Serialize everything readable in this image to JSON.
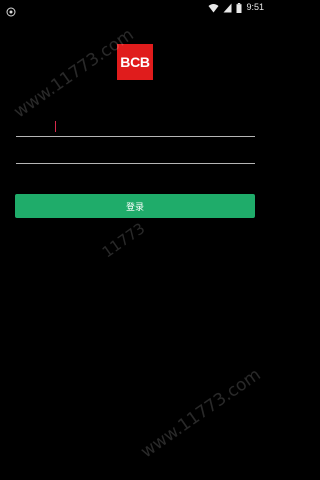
{
  "status_bar": {
    "time": "9:51",
    "icons": [
      "notification-icon",
      "wifi-icon",
      "signal-icon",
      "battery-icon"
    ]
  },
  "logo": {
    "text": "BCB",
    "color": "#e01c1c"
  },
  "login_form": {
    "username": {
      "value": "",
      "placeholder": ""
    },
    "password": {
      "value": "",
      "placeholder": ""
    },
    "submit_label": "登录",
    "submit_color": "#1fac6a"
  },
  "watermark": {
    "text": "www.11773.com",
    "text_short": "11773"
  }
}
